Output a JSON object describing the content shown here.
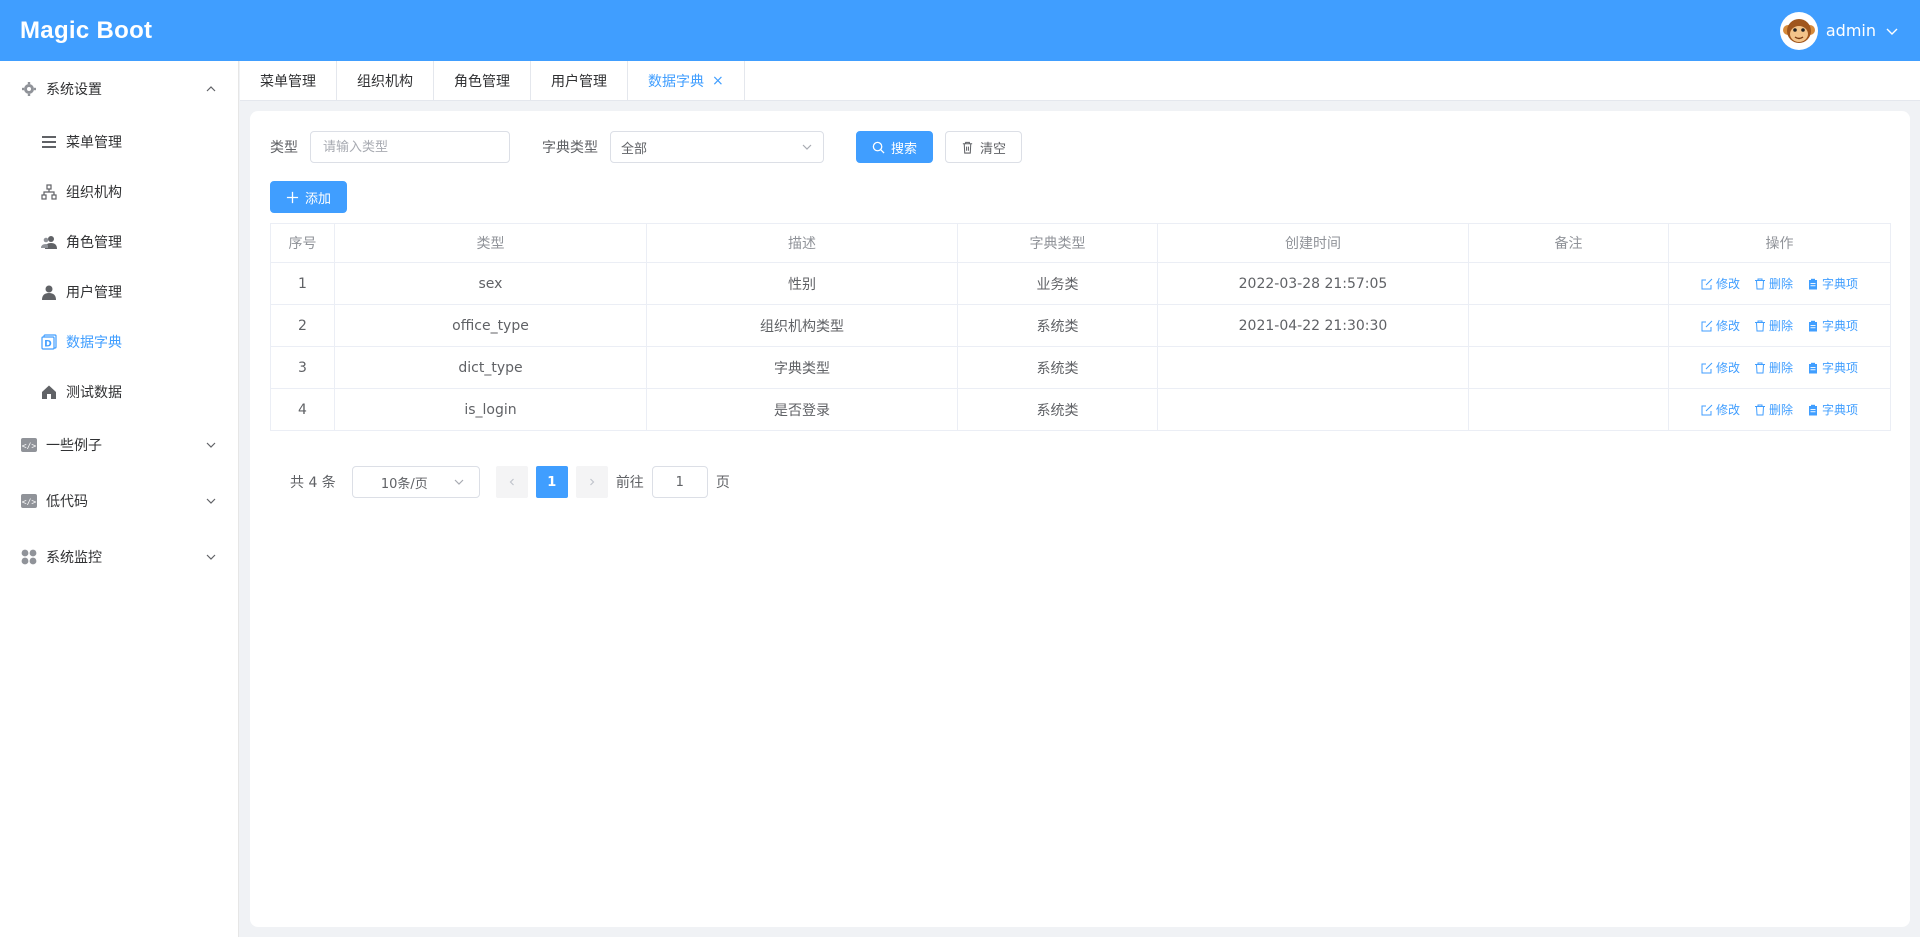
{
  "app": {
    "title": "Magic Boot"
  },
  "user": {
    "name": "admin"
  },
  "sidebar": {
    "group_system": "系统设置",
    "items": [
      {
        "label": "菜单管理"
      },
      {
        "label": "组织机构"
      },
      {
        "label": "角色管理"
      },
      {
        "label": "用户管理"
      },
      {
        "label": "数据字典"
      },
      {
        "label": "测试数据"
      }
    ],
    "group_examples": "一些例子",
    "group_lowcode": "低代码",
    "group_monitor": "系统监控"
  },
  "tabs": [
    {
      "label": "菜单管理"
    },
    {
      "label": "组织机构"
    },
    {
      "label": "角色管理"
    },
    {
      "label": "用户管理"
    },
    {
      "label": "数据字典"
    }
  ],
  "search": {
    "type_label": "类型",
    "type_placeholder": "请输入类型",
    "dict_type_label": "字典类型",
    "dict_type_value": "全部",
    "search_btn": "搜索",
    "clear_btn": "清空"
  },
  "add_btn": "添加",
  "table": {
    "headers": [
      "序号",
      "类型",
      "描述",
      "字典类型",
      "创建时间",
      "备注",
      "操作"
    ],
    "rows": [
      {
        "no": "1",
        "type": "sex",
        "desc": "性别",
        "dict_type": "业务类",
        "created": "2022-03-28 21:57:05",
        "remark": ""
      },
      {
        "no": "2",
        "type": "office_type",
        "desc": "组织机构类型",
        "dict_type": "系统类",
        "created": "2021-04-22 21:30:30",
        "remark": ""
      },
      {
        "no": "3",
        "type": "dict_type",
        "desc": "字典类型",
        "dict_type": "系统类",
        "created": "",
        "remark": ""
      },
      {
        "no": "4",
        "type": "is_login",
        "desc": "是否登录",
        "dict_type": "系统类",
        "created": "",
        "remark": ""
      }
    ],
    "ops": {
      "edit": "修改",
      "delete": "删除",
      "items": "字典项"
    }
  },
  "pagination": {
    "total": "共 4 条",
    "page_size": "10条/页",
    "current": "1",
    "goto_label": "前往",
    "goto_value": "1",
    "page_suffix": "页"
  },
  "colors": {
    "primary": "#409eff",
    "header": "#409eff"
  }
}
